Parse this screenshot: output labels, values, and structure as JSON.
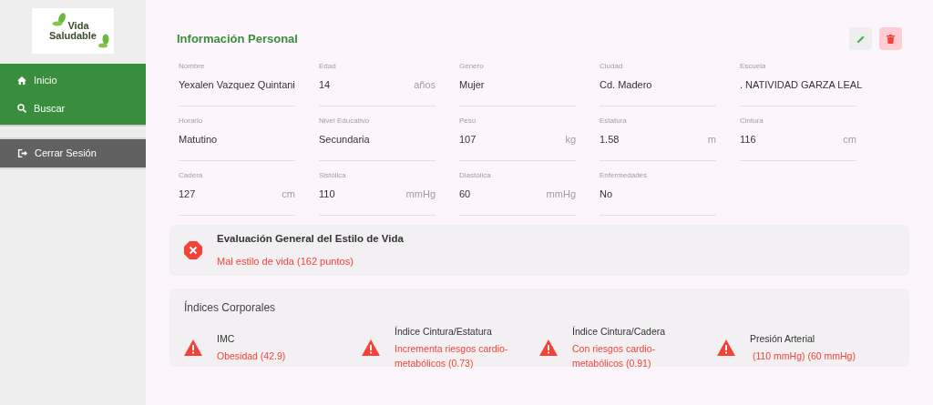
{
  "logo": {
    "line_1": "Vida",
    "line_2": "Saludable"
  },
  "sidebar": {
    "items": [
      {
        "label": "Inicio"
      },
      {
        "label": "Buscar"
      }
    ],
    "logout": {
      "label": "Cerrar Sesión"
    }
  },
  "personal_info": {
    "title": "Información Personal",
    "fields": [
      {
        "label": "Nombre",
        "value": "Yexalen Vazquez Quintani"
      },
      {
        "label": "Edad",
        "value": "14",
        "unit": "años"
      },
      {
        "label": "Género",
        "value": "Mujer"
      },
      {
        "label": "Ciudad",
        "value": "Cd. Madero"
      },
      {
        "label": "Escuela",
        "value": ". NATIVIDAD GARZA LEAL"
      },
      {
        "label": "Horario",
        "value": "Matutino"
      },
      {
        "label": "Nivel Educativo",
        "value": "Secundaria"
      },
      {
        "label": "Peso",
        "value": "107",
        "unit": "kg"
      },
      {
        "label": "Estatura",
        "value": "1.58",
        "unit": "m"
      },
      {
        "label": "Cintura",
        "value": "116",
        "unit": "cm"
      },
      {
        "label": "Cadera",
        "value": "127",
        "unit": "cm"
      },
      {
        "label": "Sistólica",
        "value": "110",
        "unit": "mmHg"
      },
      {
        "label": "Diastólica",
        "value": "60",
        "unit": "mmHg"
      },
      {
        "label": "Enfermedades",
        "value": "No"
      }
    ]
  },
  "evaluation": {
    "title": "Evaluación General del Estilo de Vida",
    "result": "Mal estilo de vida (162 puntos)"
  },
  "body_indices": {
    "title": "Índices Corporales",
    "items": [
      {
        "label": "IMC",
        "result": "Obesidad (42.9)"
      },
      {
        "label": "Índice Cintura/Estatura",
        "result": "Incrementa riesgos cardio-metabólicos (0.73)"
      },
      {
        "label": "Índice Cintura/Cadera",
        "result": "Con riesgos cardio-metabólicos (0.91)"
      },
      {
        "label": "Presión Arterial",
        "result": " (110 mmHg) (60 mmHg)"
      }
    ]
  }
}
